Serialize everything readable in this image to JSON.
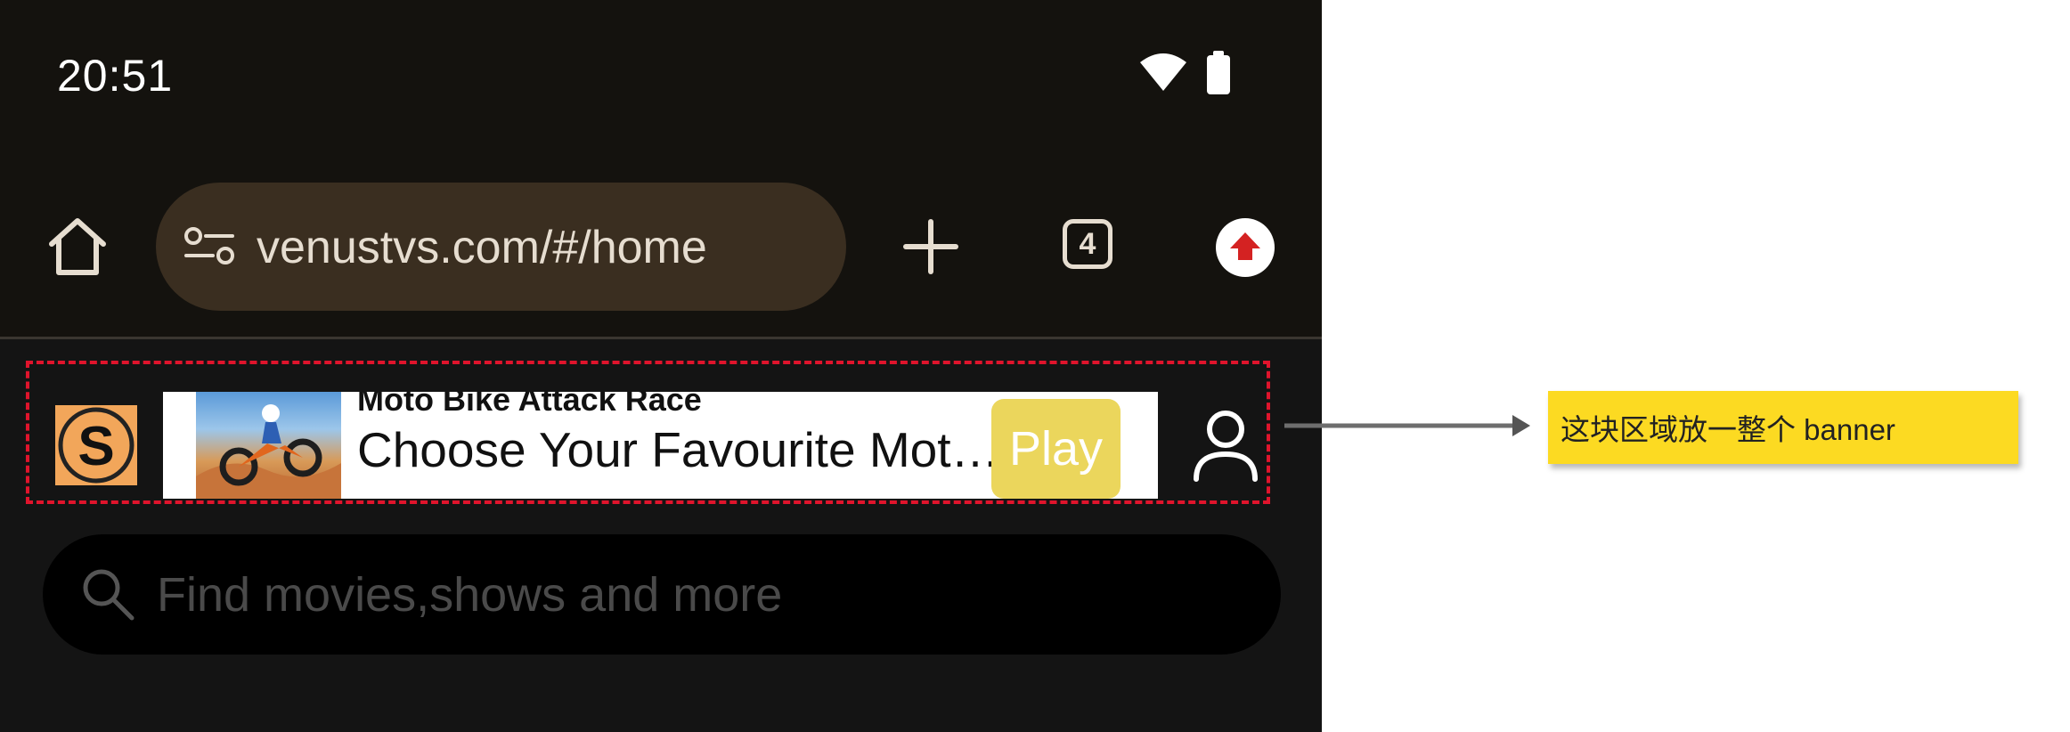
{
  "status_bar": {
    "time": "20:51",
    "icons": [
      "wifi-icon",
      "battery-icon"
    ]
  },
  "browser": {
    "url": "venustvs.com/#/home",
    "tab_count": "4",
    "icons": [
      "home-icon",
      "site-settings-icon",
      "plus-icon",
      "tab-switcher-icon",
      "update-arrow-icon"
    ]
  },
  "header": {
    "logo_letter": "S",
    "profile_icon": "person-icon"
  },
  "ad_banner": {
    "title": "Moto Bike Attack Race",
    "subtitle": "Choose Your Favourite Motorbike",
    "cta": "Play",
    "image": "motorbike-jump-image"
  },
  "search": {
    "placeholder": "Find movies,shows and more",
    "icon": "search-icon"
  },
  "annotation": {
    "note": "这块区域放一整个 banner",
    "frame_color": "#e0142c",
    "note_color": "#fcda22"
  },
  "colors": {
    "page_bg": "#141414",
    "url_bar_bg": "#3a2e20",
    "play_button": "#ebd65c",
    "logo_bg": "#f2a65a"
  }
}
